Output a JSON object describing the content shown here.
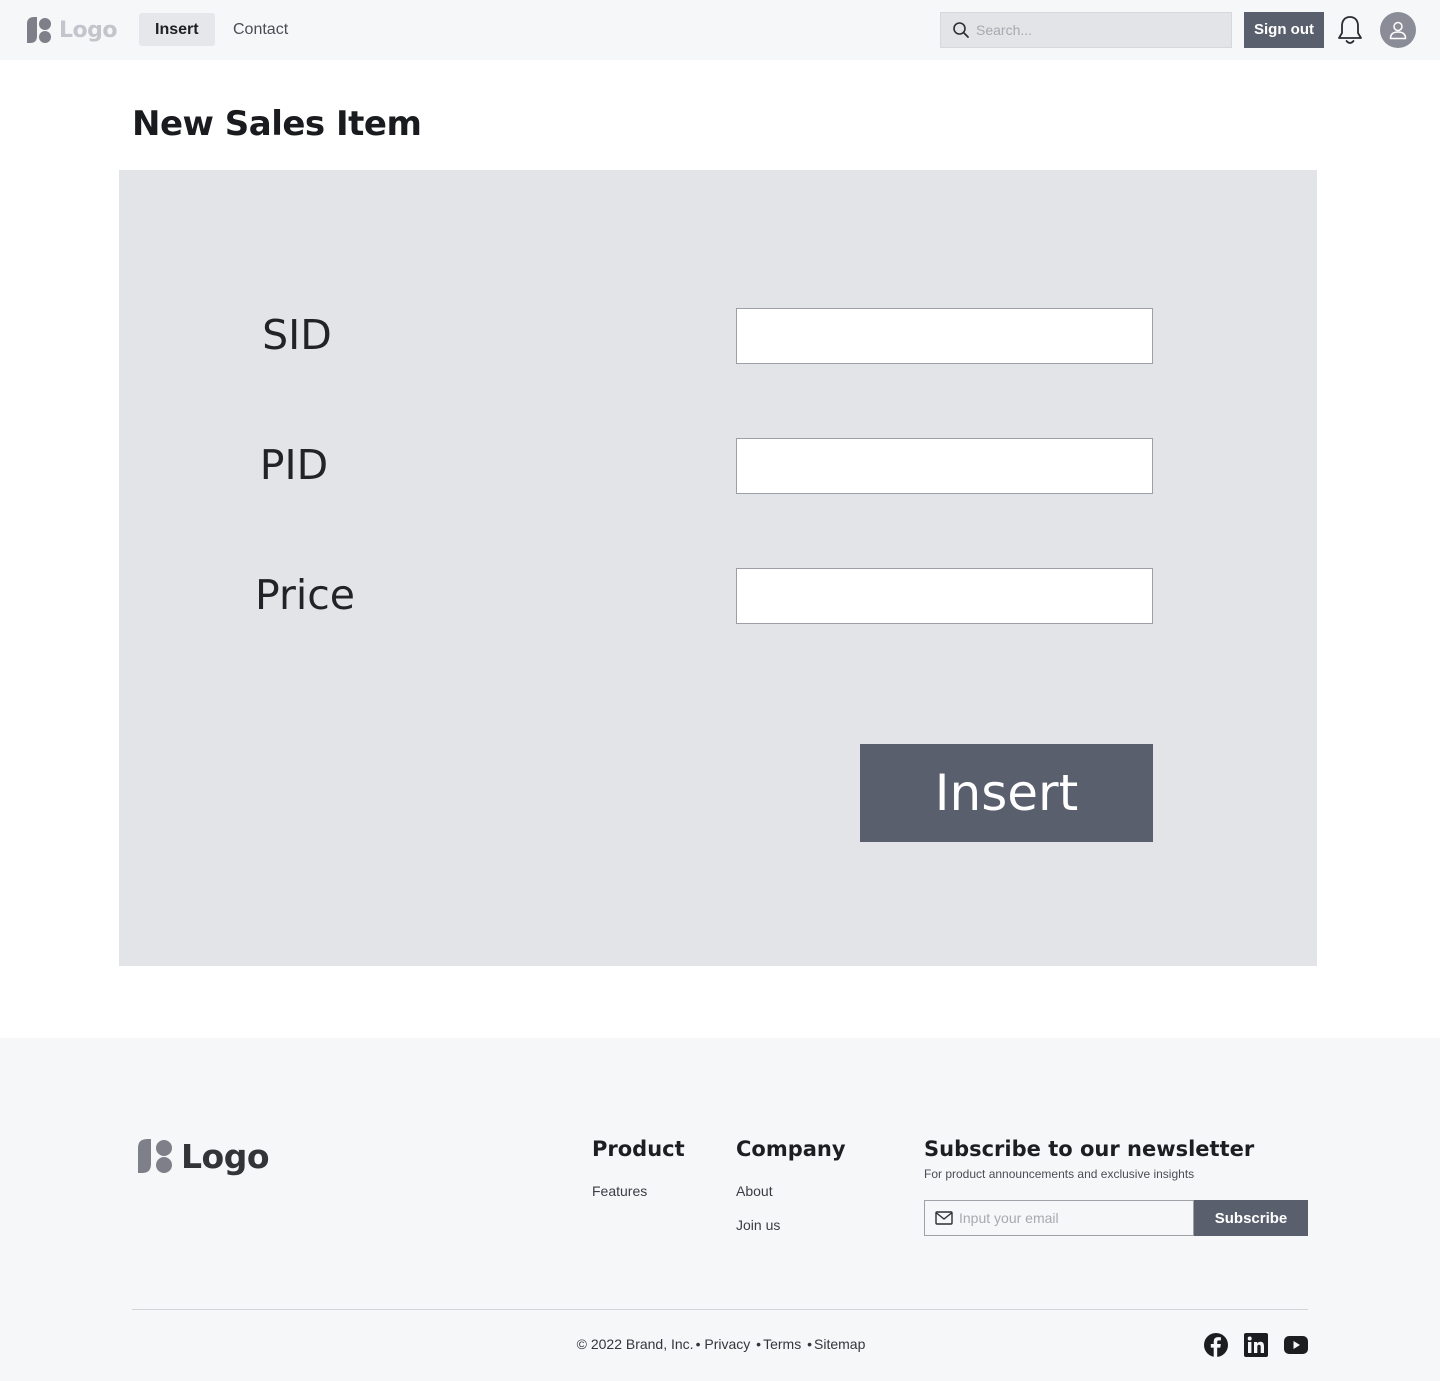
{
  "header": {
    "logo_text": "Logo",
    "nav": [
      {
        "label": "Insert",
        "active": true
      },
      {
        "label": "Contact",
        "active": false
      }
    ],
    "search_placeholder": "Search...",
    "signout_label": "Sign out",
    "icons": [
      "search-icon",
      "bell-icon",
      "user-icon"
    ]
  },
  "main": {
    "title": "New Sales Item",
    "fields": [
      {
        "label": "SID",
        "value": ""
      },
      {
        "label": "PID",
        "value": ""
      },
      {
        "label": "Price",
        "value": ""
      }
    ],
    "submit_label": "Insert"
  },
  "footer": {
    "logo_text": "Logo",
    "columns": [
      {
        "heading": "Product",
        "links": [
          "Features"
        ]
      },
      {
        "heading": "Company",
        "links": [
          "About",
          "Join us"
        ]
      }
    ],
    "newsletter": {
      "heading": "Subscribe to our newsletter",
      "subtext": "For product announcements and exclusive insights",
      "email_placeholder": "Input your email",
      "button_label": "Subscribe"
    },
    "legal": {
      "copyright": "© 2022 Brand, Inc.",
      "links": [
        "Privacy",
        "Terms",
        "Sitemap"
      ]
    },
    "social_icons": [
      "facebook-icon",
      "linkedin-icon",
      "youtube-icon"
    ]
  },
  "colors": {
    "accent": "#5a5f6e",
    "panel": "#e3e4e8",
    "topbar": "#f6f7f9"
  }
}
